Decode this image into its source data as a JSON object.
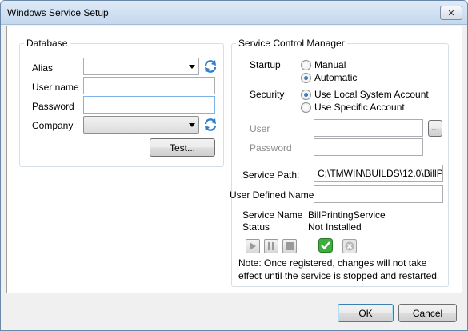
{
  "window": {
    "title": "Windows Service Setup",
    "close_glyph": "✕"
  },
  "database": {
    "legend": "Database",
    "alias_label": "Alias",
    "alias_value": "",
    "username_label": "User name",
    "username_value": "",
    "password_label": "Password",
    "password_value": "",
    "company_label": "Company",
    "company_value": "",
    "test_button": "Test..."
  },
  "scm": {
    "legend": "Service Control Manager",
    "startup_label": "Startup",
    "startup_options": [
      "Manual",
      "Automatic"
    ],
    "startup_selected": "Automatic",
    "security_label": "Security",
    "security_options": [
      "Use Local System Account",
      "Use Specific Account"
    ],
    "security_selected": "Use Local System Account",
    "user_label": "User",
    "user_value": "",
    "browse_button": "...",
    "password_label": "Password",
    "password_value": "",
    "service_path_label": "Service Path:",
    "service_path_value": "C:\\TMWIN\\BUILDS\\12.0\\BillP",
    "user_defined_name_label": "User Defined Name",
    "user_defined_name_value": "",
    "service_name_label": "Service Name",
    "service_name_value": "BillPrintingService",
    "status_label": "Status",
    "status_value": "Not Installed",
    "note": "Note:  Once registered, changes will not take effect until the service is stopped and restarted."
  },
  "footer": {
    "ok_button": "OK",
    "cancel_button": "Cancel"
  },
  "icons": {
    "refresh": "refresh-icon",
    "play": "play-icon",
    "pause": "pause-icon",
    "stop": "stop-icon",
    "install": "checkmark-icon",
    "uninstall": "remove-icon",
    "dropdown": "chevron-down-icon"
  },
  "colors": {
    "accent": "#2f7fd0",
    "install_green": "#2e9b2e",
    "disabled_text": "#8d8d8d"
  }
}
